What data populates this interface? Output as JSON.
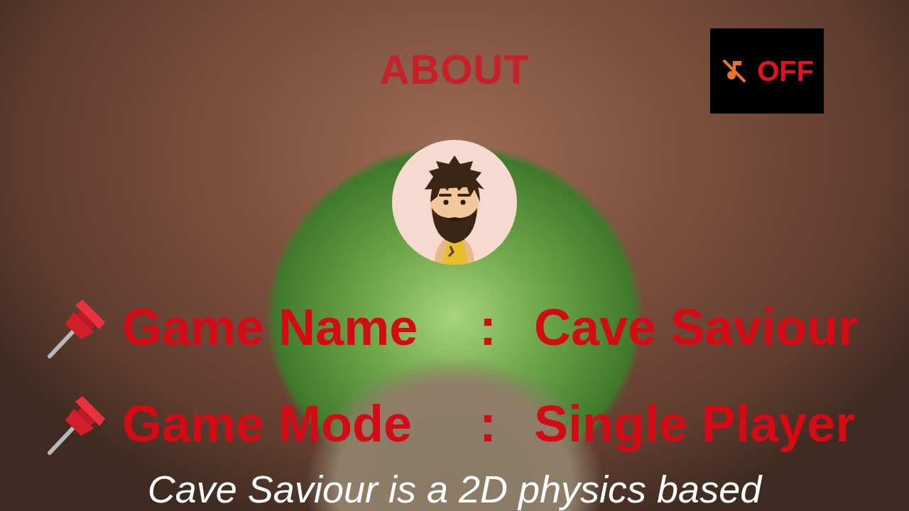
{
  "title": "ABOUT",
  "sound": {
    "label": "OFF",
    "on": false
  },
  "info": [
    {
      "label": "Game Name",
      "separator": ":",
      "value": "Cave Saviour"
    },
    {
      "label": "Game Mode",
      "separator": ":",
      "value": "Single Player"
    }
  ],
  "description": "Cave Saviour is a 2D physics based"
}
